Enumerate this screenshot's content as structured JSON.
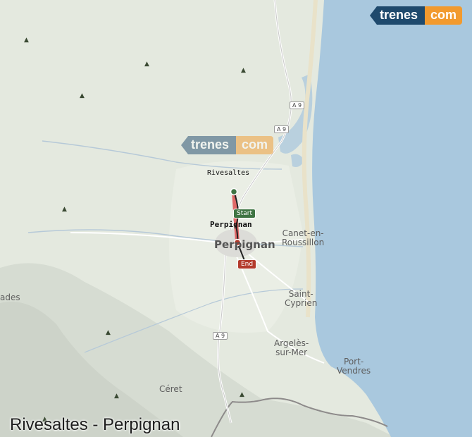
{
  "brand": {
    "left": "trenes",
    "right": "com"
  },
  "watermark": {
    "left": "trenes",
    "right": "com"
  },
  "title": "Rivesaltes - Perpignan",
  "stations": {
    "origin": "Rivesaltes",
    "destination": "Perpignan"
  },
  "markers": {
    "start": "Start",
    "end": "End"
  },
  "places": {
    "perpignan": "Perpignan",
    "canet": "Canet-en-\nRoussillon",
    "saint_cyprien": "Saint-\nCyprien",
    "argeles": "Argelès-\nsur-Mer",
    "port_vendres": "Port-\nVendres",
    "ceret": "Céret",
    "prades": "ades"
  },
  "roads": {
    "a9_north": "A 9",
    "a9_mid": "A 9",
    "a9_south": "A 9"
  },
  "colors": {
    "sea": "#a9c8de",
    "land": "#e4e9df",
    "route_line": "#e05b5b",
    "rail_line": "#222222",
    "start_marker": "#3f7443",
    "end_marker": "#b33a2c",
    "brand_blue": "#1f4a6d",
    "brand_orange": "#f29a2e"
  },
  "icons": [
    "start-pin-icon",
    "end-pin-icon",
    "tree-icon"
  ]
}
